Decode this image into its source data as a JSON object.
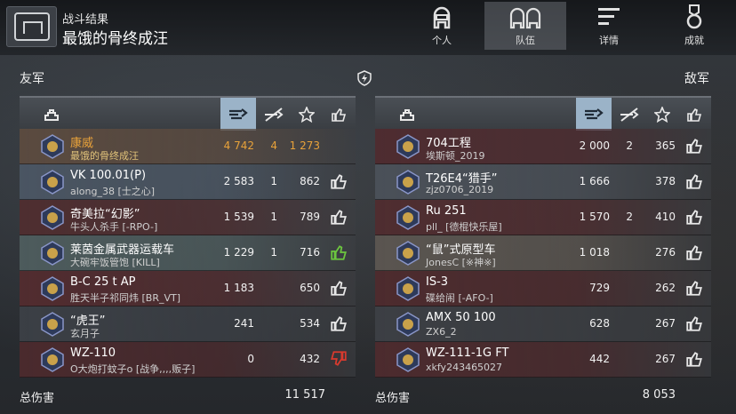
{
  "header": {
    "subtitle": "战斗结果",
    "title": "最饿的骨终成汪"
  },
  "tabs": [
    {
      "label": "个人",
      "icon": "helmet-icon",
      "active": false
    },
    {
      "label": "队伍",
      "icon": "team-icon",
      "active": true
    },
    {
      "label": "详情",
      "icon": "details-icon",
      "active": false
    },
    {
      "label": "成就",
      "icon": "medal-icon",
      "active": false
    }
  ],
  "allies": {
    "label": "友军",
    "rows": [
      {
        "tank": "康威",
        "player": "最饿的骨终成汪",
        "damage": "4 742",
        "kills": "4",
        "xp": "1 273",
        "like": "none",
        "highlight": true,
        "bg": "#5a4a3f"
      },
      {
        "tank": "VK 100.01(P)",
        "player": "along_38 [士之心]",
        "damage": "2 583",
        "kills": "1",
        "xp": "862",
        "like": "outline",
        "highlight": false,
        "bg": "#4a5562"
      },
      {
        "tank": "奇美拉“幻影”",
        "player": "牛头人杀手 [-RPO-]",
        "damage": "1 539",
        "kills": "1",
        "xp": "789",
        "like": "outline",
        "highlight": false,
        "bg": "#4e2e30"
      },
      {
        "tank": "莱茵金属武器运载车",
        "player": "大碗牢饭管饱 [KILL]",
        "damage": "1 229",
        "kills": "1",
        "xp": "716",
        "like": "green",
        "highlight": false,
        "bg": "#4d5b5c"
      },
      {
        "tank": "B-C 25 t AP",
        "player": "胜天半子祁同炜 [BR_VT]",
        "damage": "1 183",
        "kills": "",
        "xp": "650",
        "like": "outline",
        "highlight": false,
        "bg": "#512c2f"
      },
      {
        "tank": "“虎王”",
        "player": "玄月子",
        "damage": "241",
        "kills": "",
        "xp": "534",
        "like": "outline",
        "highlight": false,
        "bg": "#3b3f45"
      },
      {
        "tank": "WZ-110",
        "player": "O大炮打蚊子o [战争,,,,贩子]",
        "damage": "0",
        "kills": "",
        "xp": "432",
        "like": "red",
        "highlight": false,
        "bg": "#4a2a2d"
      }
    ],
    "total_label": "总伤害",
    "total_value": "11 517"
  },
  "enemies": {
    "label": "敌军",
    "rows": [
      {
        "tank": "704工程",
        "player": "埃斯顿_2019",
        "damage": "2 000",
        "kills": "2",
        "xp": "365",
        "like": "outline",
        "highlight": false,
        "bg": "#4e2c30"
      },
      {
        "tank": "T26E4“猎手”",
        "player": "zjz0706_2019",
        "damage": "1 666",
        "kills": "",
        "xp": "378",
        "like": "outline",
        "highlight": false,
        "bg": "#4a5058"
      },
      {
        "tank": "Ru 251",
        "player": "pll_ [德棍快乐屋]",
        "damage": "1 570",
        "kills": "2",
        "xp": "410",
        "like": "outline",
        "highlight": false,
        "bg": "#4f2d30"
      },
      {
        "tank": "“鼠”式原型车",
        "player": "JonesC [※神※]",
        "damage": "1 018",
        "kills": "",
        "xp": "276",
        "like": "outline",
        "highlight": false,
        "bg": "#5a5550"
      },
      {
        "tank": "IS-3",
        "player": "碟给闹 [-AFO-]",
        "damage": "729",
        "kills": "",
        "xp": "262",
        "like": "outline",
        "highlight": false,
        "bg": "#4d2b2e"
      },
      {
        "tank": "AMX 50 100",
        "player": "ZX6_2",
        "damage": "628",
        "kills": "",
        "xp": "267",
        "like": "outline",
        "highlight": false,
        "bg": "#3c3f44"
      },
      {
        "tank": "WZ-111-1G FT",
        "player": "xkfy243465027",
        "damage": "442",
        "kills": "",
        "xp": "267",
        "like": "outline",
        "highlight": false,
        "bg": "#4c2b2e"
      }
    ],
    "total_label": "总伤害",
    "total_value": "8 053"
  },
  "colors": {
    "highlight": "#e8a23a",
    "like_green": "#6cc63f",
    "like_red": "#d83a2e"
  }
}
